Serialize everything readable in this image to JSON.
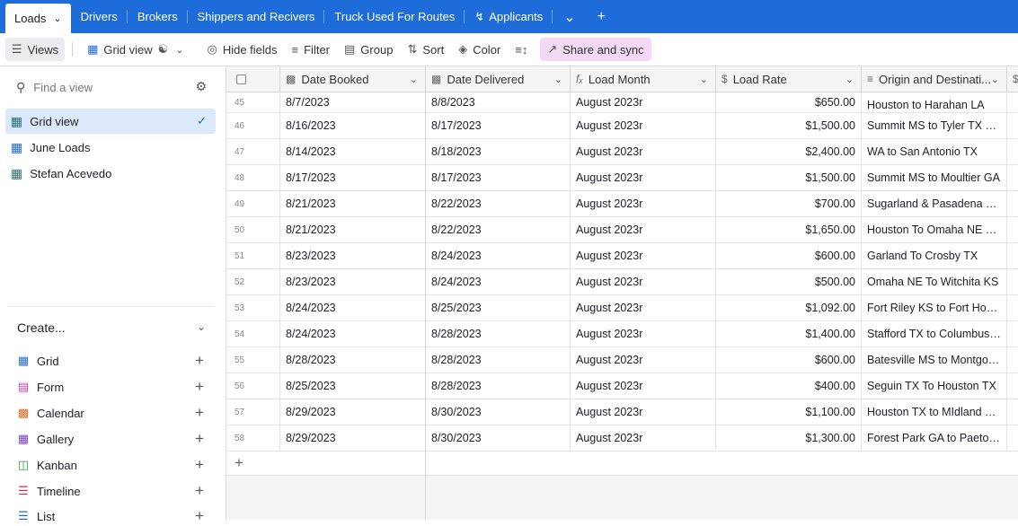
{
  "tabs": {
    "active": "Loads",
    "items": [
      "Drivers",
      "Brokers",
      "Shippers and Recivers",
      "Truck Used For Routes",
      "Applicants"
    ]
  },
  "toolbar": {
    "views": "Views",
    "grid_view": "Grid view",
    "hide_fields": "Hide fields",
    "filter": "Filter",
    "group": "Group",
    "sort": "Sort",
    "color": "Color",
    "share": "Share and sync"
  },
  "sidebar": {
    "find_placeholder": "Find a view",
    "views": [
      "Grid view",
      "June Loads",
      "Stefan Acevedo"
    ],
    "create_label": "Create...",
    "create_items": [
      "Grid",
      "Form",
      "Calendar",
      "Gallery",
      "Kanban",
      "Timeline",
      "List"
    ]
  },
  "grid": {
    "columns": [
      "Date Booked",
      "Date Delivered",
      "Load Month",
      "Load Rate",
      "Origin and Destinati..."
    ],
    "rows": [
      {
        "n": "45",
        "booked": "8/7/2023",
        "delivered": "8/8/2023",
        "month": "August 2023r",
        "rate": "$650.00",
        "origin": "Houston to Harahan LA"
      },
      {
        "n": "46",
        "booked": "8/16/2023",
        "delivered": "8/17/2023",
        "month": "August 2023r",
        "rate": "$1,500.00",
        "origin": "Summit MS to Tyler TX Rou..."
      },
      {
        "n": "47",
        "booked": "8/14/2023",
        "delivered": "8/18/2023",
        "month": "August 2023r",
        "rate": "$2,400.00",
        "origin": "WA to San Antonio TX"
      },
      {
        "n": "48",
        "booked": "8/17/2023",
        "delivered": "8/17/2023",
        "month": "August 2023r",
        "rate": "$1,500.00",
        "origin": "Summit MS to Moultier GA"
      },
      {
        "n": "49",
        "booked": "8/21/2023",
        "delivered": "8/22/2023",
        "month": "August 2023r",
        "rate": "$700.00",
        "origin": "Sugarland & Pasadena TX t..."
      },
      {
        "n": "50",
        "booked": "8/21/2023",
        "delivered": "8/22/2023",
        "month": "August 2023r",
        "rate": "$1,650.00",
        "origin": "Houston To Omaha NE & D..."
      },
      {
        "n": "51",
        "booked": "8/23/2023",
        "delivered": "8/24/2023",
        "month": "August 2023r",
        "rate": "$600.00",
        "origin": "Garland To Crosby TX"
      },
      {
        "n": "52",
        "booked": "8/23/2023",
        "delivered": "8/24/2023",
        "month": "August 2023r",
        "rate": "$500.00",
        "origin": "Omaha NE To Witchita KS"
      },
      {
        "n": "53",
        "booked": "8/24/2023",
        "delivered": "8/25/2023",
        "month": "August 2023r",
        "rate": "$1,092.00",
        "origin": "Fort Riley KS to Fort Hood ..."
      },
      {
        "n": "54",
        "booked": "8/24/2023",
        "delivered": "8/28/2023",
        "month": "August 2023r",
        "rate": "$1,400.00",
        "origin": "Stafford TX to Columbus M..."
      },
      {
        "n": "55",
        "booked": "8/28/2023",
        "delivered": "8/28/2023",
        "month": "August 2023r",
        "rate": "$600.00",
        "origin": "Batesville MS to Montgom..."
      },
      {
        "n": "56",
        "booked": "8/25/2023",
        "delivered": "8/28/2023",
        "month": "August 2023r",
        "rate": "$400.00",
        "origin": "Seguin TX To Houston TX"
      },
      {
        "n": "57",
        "booked": "8/29/2023",
        "delivered": "8/30/2023",
        "month": "August 2023r",
        "rate": "$1,100.00",
        "origin": "Houston TX to MIdland TX ..."
      },
      {
        "n": "58",
        "booked": "8/29/2023",
        "delivered": "8/30/2023",
        "month": "August 2023r",
        "rate": "$1,300.00",
        "origin": "Forest Park GA to Paetone IL"
      }
    ]
  }
}
